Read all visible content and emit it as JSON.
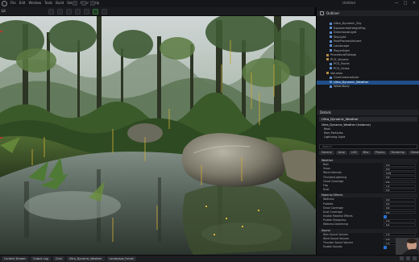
{
  "app": {
    "menu": [
      "File",
      "Edit",
      "Window",
      "Tools",
      "Build",
      "Select",
      "Actor",
      "Help"
    ],
    "project_name": "Untitled",
    "window_controls": [
      "—",
      "□",
      "✕"
    ]
  },
  "toolbar": {
    "viewport_tab": "Lit",
    "tools": [
      "select",
      "move",
      "rotate",
      "scale",
      "snap",
      "play",
      "stop"
    ]
  },
  "outliner": {
    "title": "Outliner",
    "items": [
      {
        "label": "Ultra_Dynamic_Sky",
        "icon": "actor"
      },
      {
        "label": "ExponentialHeightFog",
        "icon": "actor"
      },
      {
        "label": "DirectionalLight",
        "icon": "actor"
      },
      {
        "label": "SkyLight",
        "icon": "actor"
      },
      {
        "label": "PostProcessVolume",
        "icon": "actor"
      },
      {
        "label": "Landscape",
        "icon": "actor"
      },
      {
        "label": "PlayerStart",
        "icon": "actor"
      },
      {
        "label": "ProceduralFoliage",
        "icon": "folder"
      },
      {
        "label": "PCG_Volume",
        "icon": "folder"
      },
      {
        "label": "PCG_Rocks",
        "icon": "actor"
      },
      {
        "label": "PCG_Grass",
        "icon": "actor"
      },
      {
        "label": "Volumes",
        "icon": "folder"
      },
      {
        "label": "CineCameraActor",
        "icon": "actor"
      },
      {
        "label": "Ultra_Dynamic_Weather",
        "icon": "actor",
        "selected": true
      },
      {
        "label": "WaterBody",
        "icon": "actor"
      }
    ]
  },
  "details": {
    "title": "Details",
    "actor_name": "Ultra_Dynamic_Weather",
    "components": [
      {
        "label": "Ultra_Dynamic_Weather (Instance)",
        "top": true
      },
      {
        "label": "Root"
      },
      {
        "label": "Rain Particles"
      },
      {
        "label": "Lightning Light"
      }
    ],
    "search_placeholder": "Search",
    "tabs": [
      "General",
      "Actor",
      "LOD",
      "Misc",
      "Physics",
      "Rendering",
      "Streaming",
      "All"
    ],
    "active_tab": "All",
    "sections": [
      {
        "title": "Weather",
        "rows": [
          {
            "label": "Rain",
            "value": "0.0"
          },
          {
            "label": "Snow",
            "value": "0.0"
          },
          {
            "label": "Wind Intensity",
            "value": "0.35"
          },
          {
            "label": "Thunder/Lightning",
            "value": "0.0"
          },
          {
            "label": "Cloud Coverage",
            "value": "2.5"
          },
          {
            "label": "Fog",
            "value": "1.2"
          },
          {
            "label": "Dust",
            "value": "0.0"
          }
        ]
      },
      {
        "title": "Material Effects",
        "rows": [
          {
            "label": "Wetness",
            "value": "0.0"
          },
          {
            "label": "Puddles",
            "value": "0.5"
          },
          {
            "label": "Snow Coverage",
            "value": "0.0"
          },
          {
            "label": "Dust Coverage",
            "value": "0.0"
          },
          {
            "label": "Enable Material Effects",
            "check": true
          },
          {
            "label": "Puddle Sharpness",
            "value": "1.0"
          },
          {
            "label": "Wetness Darkening",
            "value": "0.4"
          }
        ]
      },
      {
        "title": "Sound",
        "rows": [
          {
            "label": "Rain Sound Volume",
            "value": "1.0"
          },
          {
            "label": "Wind Sound Volume",
            "value": "1.0"
          },
          {
            "label": "Thunder Sound Volume",
            "value": "1.0"
          },
          {
            "label": "Enable Sounds",
            "check": true
          }
        ]
      }
    ]
  },
  "statusbar": {
    "items": [
      "Content Drawer",
      "Output Log",
      "Cmd",
      "Ultra_Dynamic_Weather",
      "Landscape_Forest"
    ]
  },
  "colors": {
    "accent": "#2a6fd2",
    "selected_row": "#1f4f8a",
    "panel_bg": "#16171a"
  }
}
